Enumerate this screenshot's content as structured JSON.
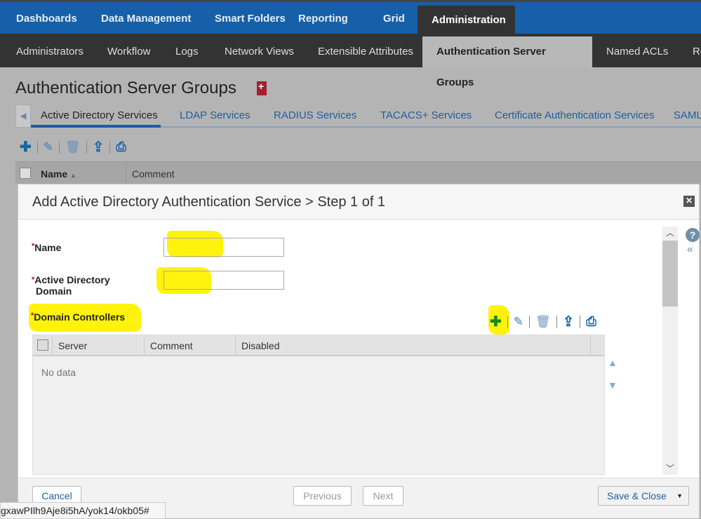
{
  "top_nav": [
    "Dashboards",
    "Data Management",
    "Smart Folders",
    "Reporting",
    "Grid",
    "Administration"
  ],
  "sub_nav": [
    "Administrators",
    "Workflow",
    "Logs",
    "Network Views",
    "Extensible Attributes",
    "Authentication Server Groups",
    "Named ACLs",
    "Re"
  ],
  "page_title": "Authentication Server Groups",
  "tabs": [
    "Active Directory Services",
    "LDAP Services",
    "RADIUS Services",
    "TACACS+ Services",
    "Certificate Authentication Services",
    "SAML"
  ],
  "grid_columns": [
    "Name",
    "Comment"
  ],
  "modal": {
    "title": "Add Active Directory Authentication Service > Step 1 of 1",
    "required_mark": "*",
    "name_label": "Name",
    "domain_label_1": "Active Directory",
    "domain_label_2": "Domain",
    "dc_label": "Domain Controllers",
    "dc_columns": [
      "Server",
      "Comment",
      "Disabled"
    ],
    "empty_text": "No data",
    "cancel": "Cancel",
    "previous": "Previous",
    "next": "Next",
    "save_close": "Save & Close",
    "help": "?"
  },
  "status_url": "gxawPIlh9Aje8i5hA/yok14/okb05#",
  "colors": {
    "nav_blue": "#1560a8",
    "dark_bar": "#333333",
    "link_blue": "#1f5e9e",
    "highlight": "#fff200",
    "add_green": "#1a8a1a"
  }
}
